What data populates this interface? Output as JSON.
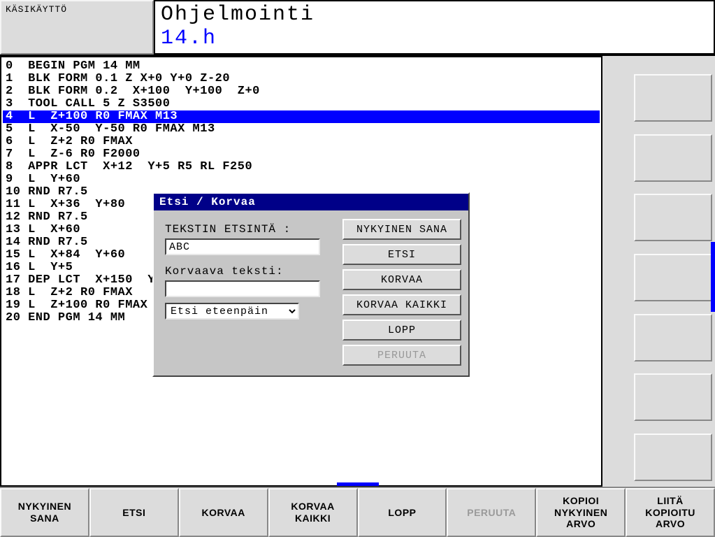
{
  "header": {
    "mode_label": "KÄSIKÄYTTÖ",
    "title_main": "Ohjelmointi",
    "title_sub": "14.h"
  },
  "code": {
    "lines": [
      "0  BEGIN PGM 14 MM",
      "1  BLK FORM 0.1 Z X+0 Y+0 Z-20",
      "2  BLK FORM 0.2  X+100  Y+100  Z+0",
      "3  TOOL CALL 5 Z S3500",
      "4  L  Z+100 R0 FMAX M13",
      "5  L  X-50  Y-50 R0 FMAX M13",
      "6  L  Z+2 R0 FMAX",
      "7  L  Z-6 R0 F2000",
      "8  APPR LCT  X+12  Y+5 R5 RL F250",
      "9  L  Y+60",
      "10 RND R7.5",
      "11 L  X+36  Y+80",
      "12 RND R7.5",
      "13 L  X+60",
      "14 RND R7.5",
      "15 L  X+84  Y+60",
      "16 L  Y+5",
      "17 DEP LCT  X+150  Y",
      "18 L  Z+2 R0 FMAX",
      "19 L  Z+100 R0 FMAX",
      "20 END PGM 14 MM"
    ],
    "selected_index": 4
  },
  "dialog": {
    "title": "Etsi / Korvaa",
    "search_label": "TEKSTIN ETSINTÄ :",
    "search_value": "ABC",
    "replace_label": "Korvaava teksti:",
    "replace_value": "",
    "direction_value": "Etsi eteenpäin",
    "buttons": {
      "current_word": "NYKYINEN SANA",
      "find": "ETSI",
      "replace": "KORVAA",
      "replace_all": "KORVAA KAIKKI",
      "end": "LOPP",
      "cancel": "PERUUTA"
    }
  },
  "bottom": {
    "b0": "NYKYINEN\nSANA",
    "b1": "ETSI",
    "b2": "KORVAA",
    "b3": "KORVAA\nKAIKKI",
    "b4": "LOPP",
    "b5": "PERUUTA",
    "b6": "KOPIOI\nNYKYINEN\nARVO",
    "b7": "LIITÄ\nKOPIOITU\nARVO"
  }
}
